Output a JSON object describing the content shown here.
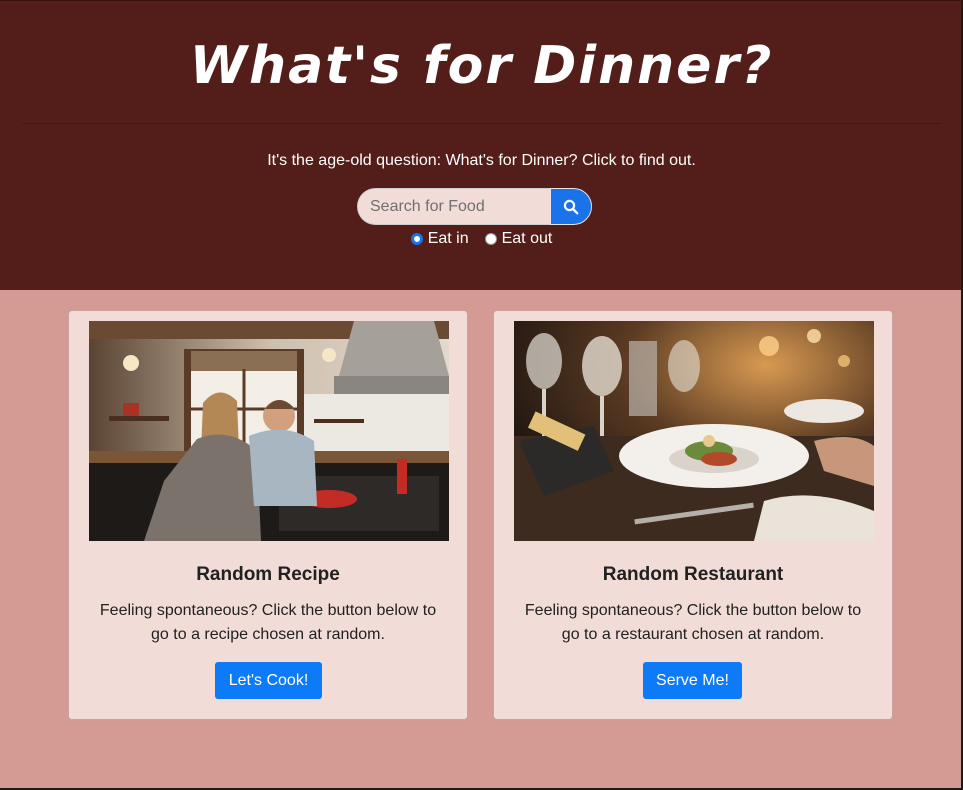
{
  "header": {
    "title": "What's for Dinner?",
    "lead": "It's the age-old question: What's for Dinner? Click to find out."
  },
  "search": {
    "placeholder": "Search for Food",
    "value": "",
    "button_icon": "search-icon"
  },
  "options": {
    "eat_in_label": "Eat in",
    "eat_out_label": "Eat out",
    "selected": "Eat in"
  },
  "cards": [
    {
      "title": "Random Recipe",
      "text": "Feeling spontaneous? Click the button below to go to a recipe chosen at random.",
      "button": "Let's Cook!"
    },
    {
      "title": "Random Restaurant",
      "text": "Feeling spontaneous? Click the button below to go to a restaurant chosen at random.",
      "button": "Serve Me!"
    }
  ],
  "colors": {
    "hero_bg": "#531d19",
    "page_bg": "#d49b94",
    "card_bg": "#f2dcd8",
    "accent": "#0d7bf7"
  }
}
